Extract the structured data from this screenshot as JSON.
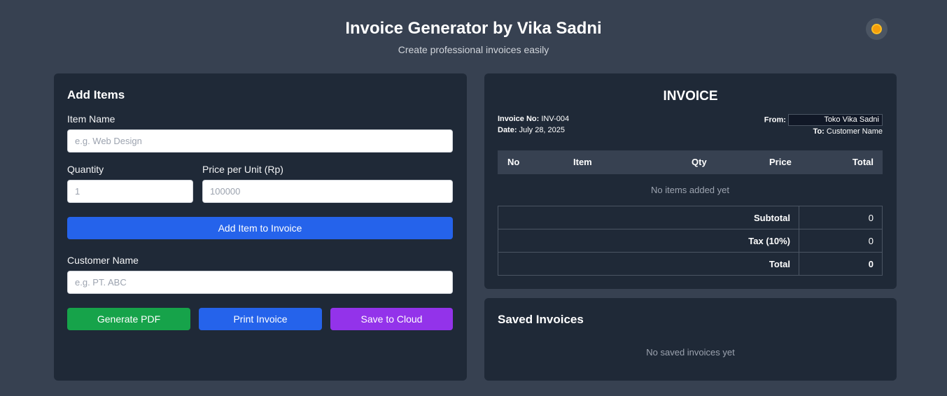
{
  "header": {
    "title": "Invoice Generator by Vika Sadni",
    "subtitle": "Create professional invoices easily"
  },
  "form": {
    "heading": "Add Items",
    "item_name_label": "Item Name",
    "item_name_placeholder": "e.g. Web Design",
    "quantity_label": "Quantity",
    "quantity_placeholder": "1",
    "price_label": "Price per Unit (Rp)",
    "price_placeholder": "100000",
    "add_button": "Add Item to Invoice",
    "customer_label": "Customer Name",
    "customer_placeholder": "e.g. PT. ABC",
    "generate_pdf": "Generate PDF",
    "print_invoice": "Print Invoice",
    "save_cloud": "Save to Cloud"
  },
  "invoice": {
    "title": "INVOICE",
    "invoice_no_label": "Invoice No:",
    "invoice_no": "INV-004",
    "date_label": "Date:",
    "date": "July 28, 2025",
    "from_label": "From:",
    "from_value": "Toko Vika Sadni",
    "to_label": "To:",
    "to_value": "Customer Name",
    "columns": [
      "No",
      "Item",
      "Qty",
      "Price",
      "Total"
    ],
    "empty_text": "No items added yet",
    "subtotal_label": "Subtotal",
    "subtotal": "0",
    "tax_label": "Tax (10%)",
    "tax": "0",
    "total_label": "Total",
    "total": "0"
  },
  "saved": {
    "heading": "Saved Invoices",
    "empty_text": "No saved invoices yet"
  },
  "colors": {
    "background": "#374151",
    "panel": "#1f2937",
    "primary": "#2563eb",
    "success": "#16a34a",
    "cloud": "#9333ea"
  },
  "icons": {
    "theme_toggle": "sun-icon"
  }
}
